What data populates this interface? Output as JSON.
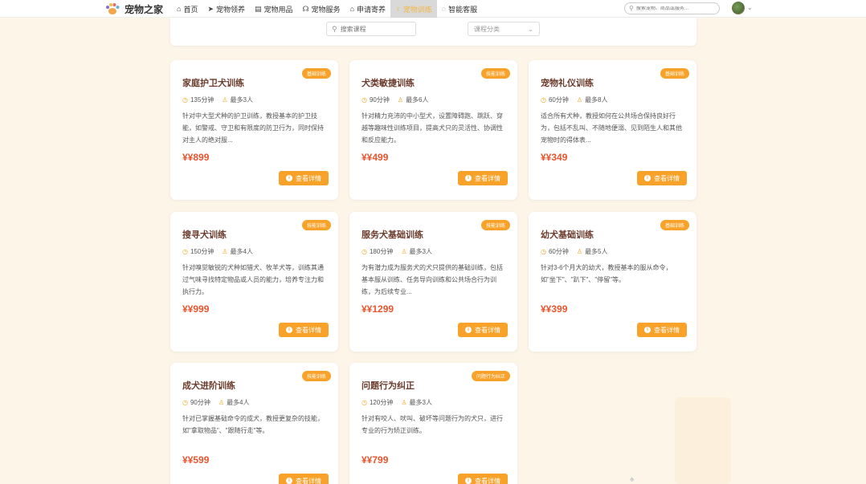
{
  "header": {
    "brand": "宠物之家",
    "nav": [
      {
        "icon": "home-icon",
        "label": "首页",
        "active": false
      },
      {
        "icon": "send-icon",
        "label": "宠物领养",
        "active": false
      },
      {
        "icon": "shop-icon",
        "label": "宠物用品",
        "active": false
      },
      {
        "icon": "headset-icon",
        "label": "宠物服务",
        "active": false
      },
      {
        "icon": "house-icon",
        "label": "申请寄养",
        "active": false
      },
      {
        "icon": "lightbulb-icon",
        "label": "宠物训练",
        "active": true
      },
      {
        "icon": "chat-icon",
        "label": "智能客服",
        "active": false
      }
    ],
    "search_placeholder": "搜索宠物、商品或服务..."
  },
  "filter": {
    "search_placeholder": "搜索课程",
    "category_placeholder": "课程分类"
  },
  "colors": {
    "accent": "#f8a229",
    "price": "#e8552e",
    "title": "#6b3a2a",
    "background": "#fdf5e8"
  },
  "detail_label": "查看详情",
  "courses": [
    {
      "title": "家庭护卫犬训练",
      "badge": "基础训练",
      "duration": "135分钟",
      "capacity": "最多3人",
      "desc": "针对中大型犬种的护卫训练，教授基本的护卫技能，如警戒、守卫和有限度的防卫行为，同时保持对主人的绝对服...",
      "price": "¥¥899"
    },
    {
      "title": "犬类敏捷训练",
      "badge": "技能训练",
      "duration": "90分钟",
      "capacity": "最多6人",
      "desc": "针对精力充沛的中小型犬，设置障碍跑、跳跃、穿越等趣味性训练项目，提高犬只的灵活性、协调性和反应能力。",
      "price": "¥¥499"
    },
    {
      "title": "宠物礼仪训练",
      "badge": "基础训练",
      "duration": "60分钟",
      "capacity": "最多8人",
      "desc": "适合所有犬种，教授如何在公共场合保持良好行为，包括不乱叫、不随地便溺、见到陌生人和其他宠物时的得体表...",
      "price": "¥¥349"
    },
    {
      "title": "搜寻犬训练",
      "badge": "技能训练",
      "duration": "150分钟",
      "capacity": "最多4人",
      "desc": "针对嗅觉敏锐的犬种如猎犬、牧羊犬等，训练其通过气味寻找特定物品或人员的能力，培养专注力和执行力。",
      "price": "¥¥999"
    },
    {
      "title": "服务犬基础训练",
      "badge": "技能训练",
      "duration": "180分钟",
      "capacity": "最多3人",
      "desc": "为有潜力成为服务犬的犬只提供的基础训练，包括基本服从训练、任务导向训练和公共场合行为训练，为后续专业...",
      "price": "¥¥1299"
    },
    {
      "title": "幼犬基础训练",
      "badge": "基础训练",
      "duration": "60分钟",
      "capacity": "最多5人",
      "desc": "针对3-6个月大的幼犬，教授基本的服从命令，如\"坐下\"、\"趴下\"、\"停留\"等。",
      "price": "¥¥399"
    },
    {
      "title": "成犬进阶训练",
      "badge": "技能训练",
      "duration": "90分钟",
      "capacity": "最多4人",
      "desc": "针对已掌握基础命令的成犬，教授更复杂的技能，如\"拿取物品\"、\"跟随行走\"等。",
      "price": "¥¥599"
    },
    {
      "title": "问题行为纠正",
      "badge": "问题行为纠正",
      "duration": "120分钟",
      "capacity": "最多3人",
      "desc": "针对有咬人、吠叫、破坏等问题行为的犬只，进行专业的行为矫正训练。",
      "price": "¥¥799"
    }
  ]
}
